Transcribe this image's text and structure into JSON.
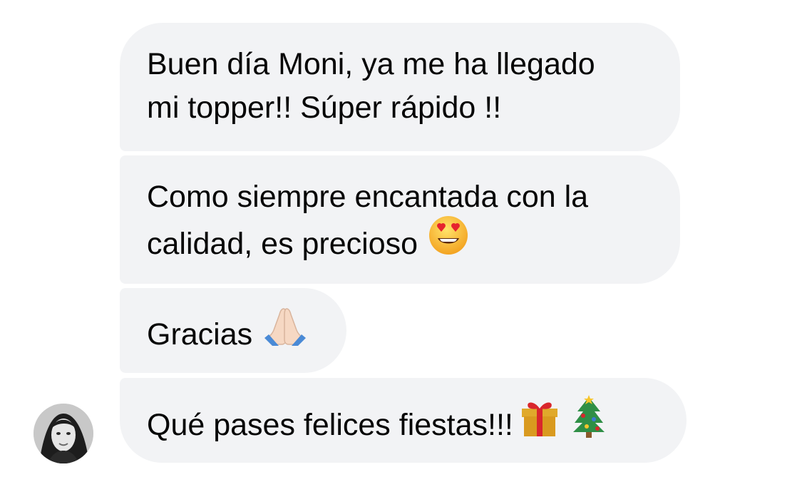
{
  "messages": [
    {
      "text": "Buen día Moni, ya me ha llegado\nmi topper!! Súper rápido !!",
      "emoji": ""
    },
    {
      "text": "Como siempre encantada con la\ncalidad, es precioso",
      "emoji": "heart-eyes-face-icon"
    },
    {
      "text": "Gracias",
      "emoji": "folded-hands-icon"
    },
    {
      "text": "Qué pases felices fiestas!!!",
      "emoji": "gift-icon christmas-tree-icon"
    }
  ],
  "sender": {
    "avatar": "profile-photo"
  },
  "colors": {
    "bubble": "#f2f3f5",
    "text": "#050505",
    "background": "#ffffff"
  }
}
